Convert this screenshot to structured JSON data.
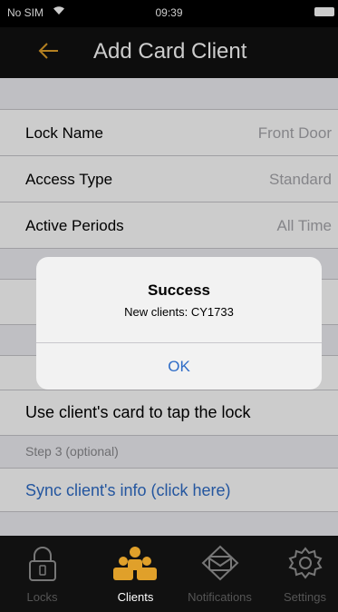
{
  "status": {
    "carrier": "No SIM",
    "time": "09:39"
  },
  "nav": {
    "title": "Add Card Client"
  },
  "rows": [
    {
      "label": "Lock Name",
      "value": "Front Door"
    },
    {
      "label": "Access Type",
      "value": "Standard"
    },
    {
      "label": "Active Periods",
      "value": "All Time"
    }
  ],
  "steps": {
    "tap_lock": "Use client's card to tap the lock",
    "step3_header": "Step 3 (optional)",
    "sync_link": "Sync client's info (click here)"
  },
  "alert": {
    "title": "Success",
    "message": "New clients: CY1733",
    "ok": "OK"
  },
  "tabs": [
    {
      "label": "Locks",
      "icon": "lock-icon"
    },
    {
      "label": "Clients",
      "icon": "clients-icon"
    },
    {
      "label": "Notifications",
      "icon": "notifications-icon"
    },
    {
      "label": "Settings",
      "icon": "gear-icon"
    }
  ],
  "colors": {
    "accent": "#e0a02a",
    "link": "#2e6cc7"
  }
}
